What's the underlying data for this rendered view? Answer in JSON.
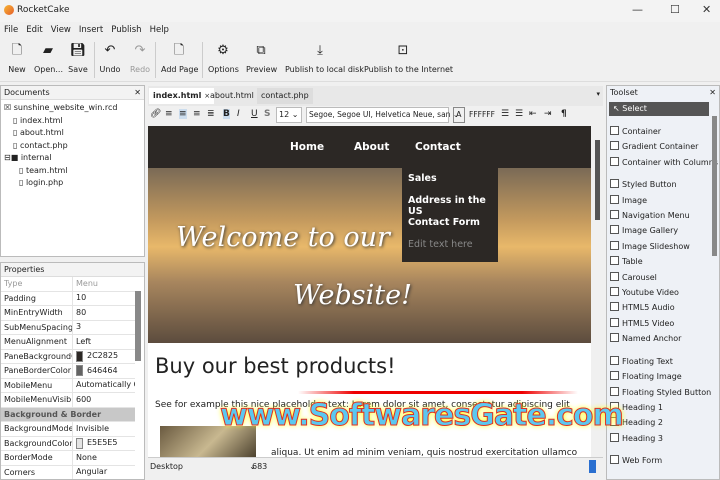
{
  "app": {
    "title": "RocketCake"
  },
  "menu": [
    "File",
    "Edit",
    "View",
    "Insert",
    "Publish",
    "Help"
  ],
  "toolbar": [
    {
      "label": "New",
      "icon": "new-file-icon"
    },
    {
      "label": "Open...",
      "icon": "folder-open-icon"
    },
    {
      "label": "Save",
      "icon": "save-icon"
    },
    {
      "label": "Undo",
      "icon": "undo-icon"
    },
    {
      "label": "Redo",
      "icon": "redo-icon"
    },
    {
      "label": "Add Page",
      "icon": "add-page-icon"
    },
    {
      "label": "Options",
      "icon": "gear-icon"
    },
    {
      "label": "Preview",
      "icon": "preview-icon"
    },
    {
      "label": "Publish to local disk",
      "icon": "download-icon"
    },
    {
      "label": "Publish to the Internet",
      "icon": "publish-web-icon"
    }
  ],
  "documents": {
    "title": "Documents",
    "root": "sunshine_website_win.rcd",
    "files": [
      "index.html",
      "about.html",
      "contact.php"
    ],
    "folder": "internal",
    "folder_files": [
      "team.html",
      "login.php"
    ]
  },
  "properties": {
    "title": "Properties",
    "rows": [
      {
        "k": "Type",
        "v": "Menu"
      },
      {
        "k": "Padding",
        "v": "10"
      },
      {
        "k": "MinEntryWidth",
        "v": "80"
      },
      {
        "k": "SubMenuSpacing",
        "v": "3"
      },
      {
        "k": "MenuAlignment",
        "v": "Left"
      },
      {
        "k": "PaneBackgroundColor",
        "v": "2C2825",
        "color": "#2c2825"
      },
      {
        "k": "PaneBorderColor",
        "v": "646464",
        "color": "#646464"
      },
      {
        "k": "MobileMenu",
        "v": "Automatically Generated"
      },
      {
        "k": "MobileMenuVisibleWidth",
        "v": "600"
      }
    ],
    "group": "Background & Border",
    "rows2": [
      {
        "k": "BackgroundMode",
        "v": "Invisible"
      },
      {
        "k": "BackgroundColor",
        "v": "E5E5E5",
        "color": "#e5e5e5"
      },
      {
        "k": "BorderMode",
        "v": "None"
      },
      {
        "k": "Corners",
        "v": "Angular"
      }
    ]
  },
  "tabs": [
    "index.html",
    "about.html",
    "contact.php"
  ],
  "format": {
    "font_size": "12",
    "font_family": "Segoe, Segoe UI, Helvetica Neue, san",
    "color_label": "A",
    "color": "FFFFFF"
  },
  "page": {
    "nav": [
      "Home",
      "About",
      "Contact"
    ],
    "submenu": [
      "Sales",
      "Address in the US",
      "Contact Form",
      "Edit text here"
    ],
    "hero_line1": "Welcome to our",
    "hero_line2": "Website!",
    "heading": "Buy our best products!",
    "para1": "See for example this nice placeholder text: Lorem dolor sit amet, consectetur adipiscing elit",
    "para2": "aliqua. Ut enim ad minim veniam, quis nostrud exercitation ullamco"
  },
  "status": {
    "device": "Desktop",
    "width": "683"
  },
  "toolset": {
    "title": "Toolset",
    "select": "Select",
    "items": [
      "Container",
      "Gradient Container",
      "Container with Columns",
      "Styled Button",
      "Image",
      "Navigation Menu",
      "Image Gallery",
      "Image Slideshow",
      "Table",
      "Carousel",
      "Youtube Video",
      "HTML5 Audio",
      "HTML5 Video",
      "Named Anchor",
      "Floating Text",
      "Floating Image",
      "Floating Styled Button",
      "Heading 1",
      "Heading 2",
      "Heading 3",
      "Web Form"
    ]
  },
  "watermark": "www.SoftwaresGate.com"
}
